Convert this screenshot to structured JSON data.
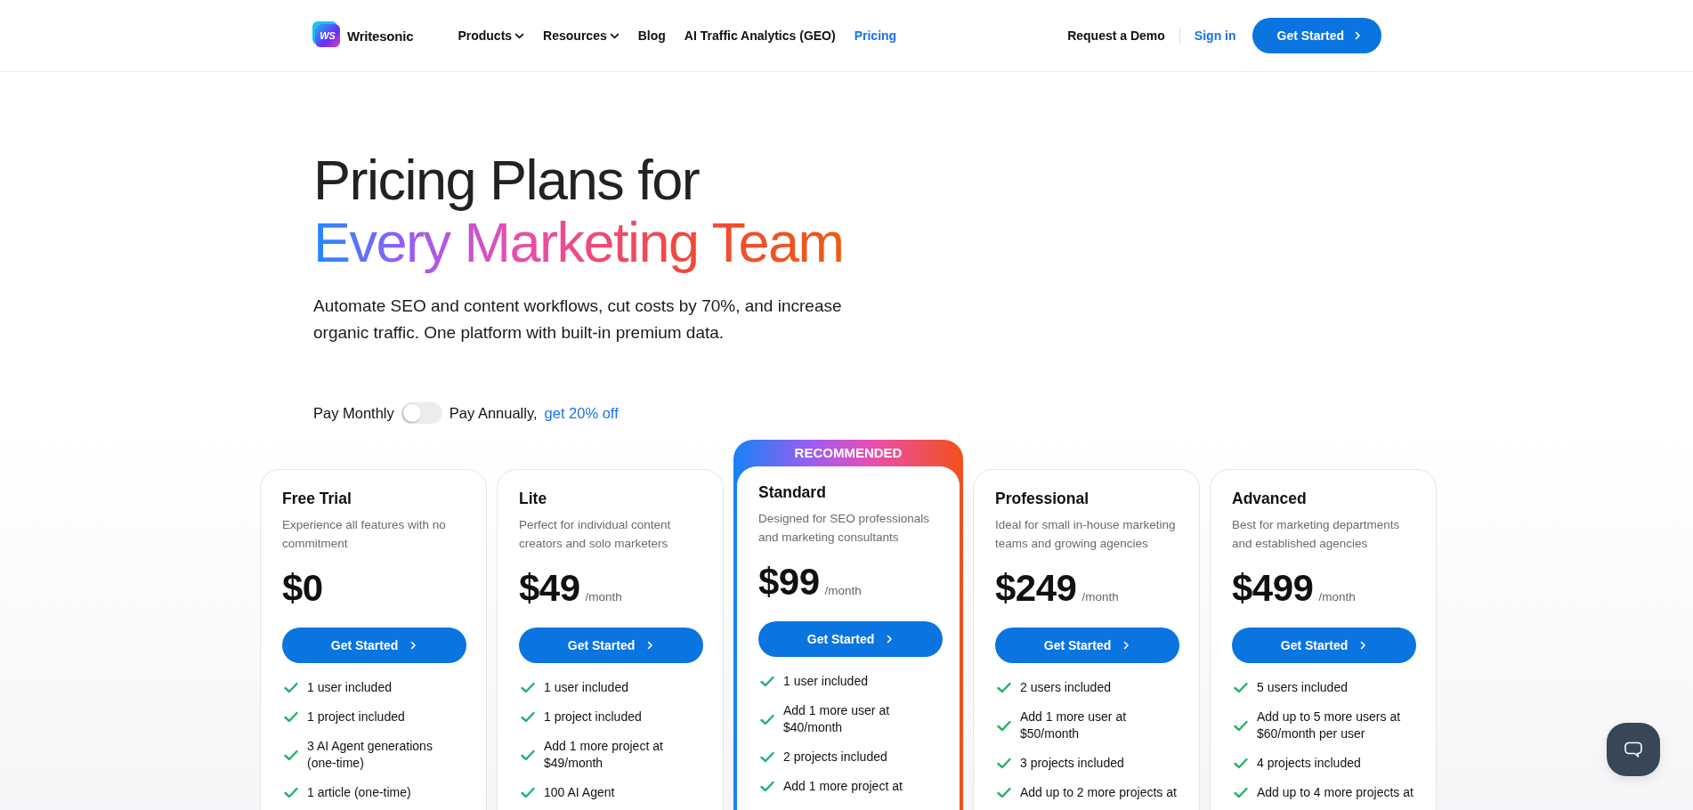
{
  "header": {
    "logo": {
      "badge": "WS",
      "name": "Writesonic"
    },
    "nav": [
      {
        "label": "Products",
        "dropdown": true,
        "selected": false
      },
      {
        "label": "Resources",
        "dropdown": true,
        "selected": false
      },
      {
        "label": "Blog",
        "dropdown": false,
        "selected": false
      },
      {
        "label": "AI Traffic Analytics (GEO)",
        "dropdown": false,
        "selected": false
      },
      {
        "label": "Pricing",
        "dropdown": false,
        "selected": true
      }
    ],
    "demo": "Request a Demo",
    "signin": "Sign in",
    "cta": "Get Started"
  },
  "hero": {
    "title_line1": "Pricing Plans for",
    "title_line2": "Every Marketing Team",
    "subtitle": "Automate SEO and content workflows, cut costs by 70%, and increase organic traffic. One platform with built-in premium data."
  },
  "billing": {
    "monthly_label": "Pay Monthly",
    "annual_label": "Pay Annually,",
    "discount": "get 20% off",
    "on": false
  },
  "plans": [
    {
      "name": "Free Trial",
      "description": "Experience all features with no commitment",
      "price": "$0",
      "recommended": false,
      "button": "Get Started",
      "features": [
        "1 user included",
        "1 project included",
        "3 AI Agent generations (one-time)",
        "1 article (one-time)"
      ]
    },
    {
      "name": "Lite",
      "description": "Perfect for individual content creators and solo marketers",
      "price": "$49",
      "period": "/month",
      "recommended": false,
      "button": "Get Started",
      "features": [
        "1 user included",
        "1 project included",
        "Add 1 more project at $49/month",
        "100 AI Agent"
      ]
    },
    {
      "name": "Standard",
      "description": "Designed for SEO professionals and marketing consultants",
      "price": "$99",
      "period": "/month",
      "recommended": true,
      "badge": "RECOMMENDED",
      "button": "Get Started",
      "features": [
        "1 user included",
        "Add 1 more user at $40/month",
        "2 projects included",
        "Add 1 more project at"
      ]
    },
    {
      "name": "Professional",
      "description": "Ideal for small in-house marketing teams and growing agencies",
      "price": "$249",
      "period": "/month",
      "recommended": false,
      "button": "Get Started",
      "features": [
        "2 users included",
        "Add 1 more user at $50/month",
        "3 projects included",
        "Add up to 2 more projects at"
      ]
    },
    {
      "name": "Advanced",
      "description": "Best for marketing departments and established agencies",
      "price": "$499",
      "period": "/month",
      "recommended": false,
      "button": "Get Started",
      "features": [
        "5 users included",
        "Add up to 5 more users at $60/month per user",
        "4 projects included",
        "Add up to 4 more projects at"
      ]
    }
  ]
}
